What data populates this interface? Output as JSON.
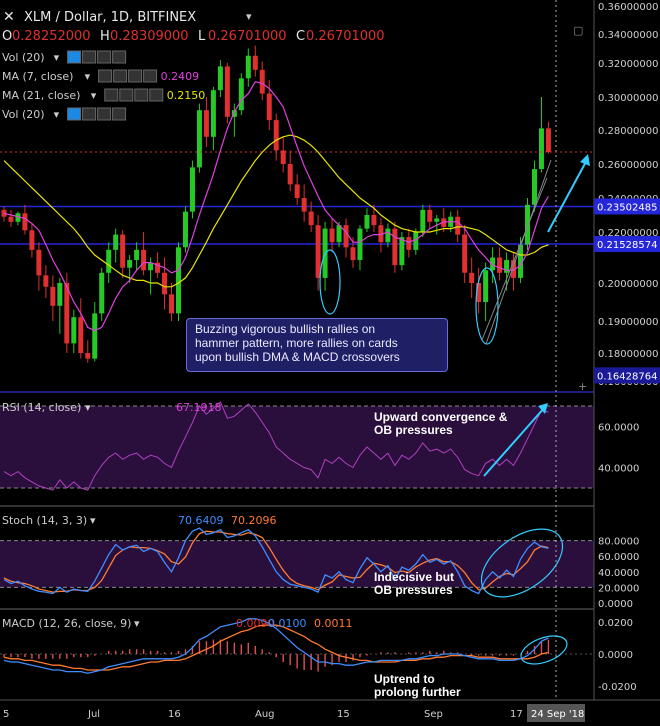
{
  "header": {
    "symbol": "XLM / Dollar, 1D, BITFINEX",
    "ohlc": [
      {
        "k": "O",
        "v": "0.28252000"
      },
      {
        "k": "H",
        "v": "0.28309000"
      },
      {
        "k": "L",
        "v": "0.26701000"
      },
      {
        "k": "C",
        "v": "0.26701000"
      }
    ]
  },
  "legend_rows": [
    {
      "label": "Vol (20)",
      "value": "",
      "value_color": "#ffffff"
    },
    {
      "label": "MA (7, close)",
      "value": "0.2409",
      "value_color": "#e040e0"
    },
    {
      "label": "MA (21, close)",
      "value": "0.2150",
      "value_color": "#e6e600"
    },
    {
      "label": "Vol (20)",
      "value": "",
      "value_color": "#ffffff"
    }
  ],
  "price_axis": {
    "ticks": [
      "0.36000000",
      "0.34000000",
      "0.32000000",
      "0.30000000",
      "0.28000000",
      "0.26000000",
      "0.24000000",
      "0.22000000",
      "0.20000000",
      "0.19000000",
      "0.18000000",
      "0.16000000"
    ],
    "tags": [
      {
        "label": "0.23502485",
        "value": 0.23502485,
        "color": "#2626d9"
      },
      {
        "label": "0.21528574",
        "value": 0.21528574,
        "color": "#2626d9"
      },
      {
        "label": "0.16428764",
        "value": 0.164,
        "color": "#1a1a99"
      }
    ]
  },
  "callout": {
    "lines": [
      "Buzzing vigorous bullish rallies on",
      "hammer pattern, more rallies on cards",
      "upon bullish DMA & MACD crossovers"
    ]
  },
  "rsi_panel": {
    "label": "RSI (14, close)",
    "value": "67.1918",
    "ticks": [
      "60.0000",
      "40.0000"
    ],
    "annotation": [
      "Upward convergence &",
      "OB pressures"
    ]
  },
  "stoch_panel": {
    "label": "Stoch (14, 3, 3)",
    "k": "70.6409",
    "d": "70.2096",
    "ticks": [
      "80.0000",
      "60.0000",
      "40.0000",
      "20.0000",
      "0.0000"
    ],
    "annotation": [
      "Indecisive but",
      "OB pressures"
    ]
  },
  "macd_panel": {
    "label": "MACD (12, 26, close, 9)",
    "hist": "0.0090",
    "macd": "0.0100",
    "signal": "0.0011",
    "ticks": [
      "0.0200",
      "0.0000",
      "-0.0200"
    ],
    "annotation": [
      "Uptrend to",
      "prolong further"
    ]
  },
  "x_axis": {
    "labels": [
      "5",
      "Jul",
      "16",
      "Aug",
      "15",
      "Sep",
      "17"
    ],
    "current": "24 Sep '18"
  },
  "colors": {
    "up": "#26c926",
    "down": "#e03030",
    "ma7": "#e040e0",
    "ma21": "#e6e600",
    "hline": "#2626d9",
    "annotation": "#33ccff"
  },
  "chart_data": {
    "type": "candlestick",
    "title": "XLM / Dollar, 1D, BITFINEX",
    "ylim": [
      0.164,
      0.36
    ],
    "ylabel": "",
    "candles": [
      [
        0.233,
        0.235,
        0.226,
        0.229
      ],
      [
        0.229,
        0.233,
        0.223,
        0.226
      ],
      [
        0.226,
        0.232,
        0.224,
        0.231
      ],
      [
        0.231,
        0.236,
        0.219,
        0.221
      ],
      [
        0.221,
        0.225,
        0.21,
        0.213
      ],
      [
        0.213,
        0.216,
        0.198,
        0.203
      ],
      [
        0.203,
        0.207,
        0.196,
        0.199
      ],
      [
        0.199,
        0.203,
        0.19,
        0.194
      ],
      [
        0.194,
        0.202,
        0.186,
        0.2
      ],
      [
        0.2,
        0.204,
        0.18,
        0.183
      ],
      [
        0.183,
        0.193,
        0.18,
        0.191
      ],
      [
        0.191,
        0.196,
        0.176,
        0.18
      ],
      [
        0.18,
        0.184,
        0.173,
        0.176
      ],
      [
        0.176,
        0.195,
        0.174,
        0.192
      ],
      [
        0.192,
        0.206,
        0.19,
        0.204
      ],
      [
        0.204,
        0.216,
        0.2,
        0.213
      ],
      [
        0.213,
        0.222,
        0.208,
        0.219
      ],
      [
        0.219,
        0.221,
        0.202,
        0.206
      ],
      [
        0.206,
        0.211,
        0.2,
        0.209
      ],
      [
        0.209,
        0.216,
        0.205,
        0.213
      ],
      [
        0.213,
        0.22,
        0.203,
        0.205
      ],
      [
        0.205,
        0.21,
        0.197,
        0.208
      ],
      [
        0.208,
        0.212,
        0.202,
        0.204
      ],
      [
        0.204,
        0.21,
        0.193,
        0.197
      ],
      [
        0.197,
        0.2,
        0.19,
        0.192
      ],
      [
        0.192,
        0.216,
        0.19,
        0.214
      ],
      [
        0.214,
        0.235,
        0.212,
        0.232
      ],
      [
        0.232,
        0.262,
        0.228,
        0.258
      ],
      [
        0.258,
        0.296,
        0.255,
        0.292
      ],
      [
        0.292,
        0.3,
        0.27,
        0.276
      ],
      [
        0.276,
        0.306,
        0.268,
        0.304
      ],
      [
        0.304,
        0.322,
        0.3,
        0.318
      ],
      [
        0.318,
        0.32,
        0.284,
        0.288
      ],
      [
        0.288,
        0.296,
        0.276,
        0.292
      ],
      [
        0.292,
        0.314,
        0.289,
        0.311
      ],
      [
        0.311,
        0.33,
        0.306,
        0.325
      ],
      [
        0.325,
        0.332,
        0.312,
        0.316
      ],
      [
        0.316,
        0.321,
        0.298,
        0.302
      ],
      [
        0.302,
        0.31,
        0.28,
        0.286
      ],
      [
        0.286,
        0.29,
        0.262,
        0.268
      ],
      [
        0.268,
        0.276,
        0.255,
        0.26
      ],
      [
        0.26,
        0.268,
        0.244,
        0.248
      ],
      [
        0.248,
        0.254,
        0.236,
        0.24
      ],
      [
        0.24,
        0.248,
        0.226,
        0.232
      ],
      [
        0.232,
        0.238,
        0.22,
        0.224
      ],
      [
        0.224,
        0.23,
        0.198,
        0.202
      ],
      [
        0.202,
        0.226,
        0.198,
        0.222
      ],
      [
        0.222,
        0.228,
        0.212,
        0.216
      ],
      [
        0.216,
        0.226,
        0.214,
        0.224
      ],
      [
        0.224,
        0.228,
        0.21,
        0.214
      ],
      [
        0.214,
        0.218,
        0.206,
        0.209
      ],
      [
        0.209,
        0.224,
        0.205,
        0.222
      ],
      [
        0.222,
        0.234,
        0.22,
        0.23
      ],
      [
        0.23,
        0.236,
        0.22,
        0.224
      ],
      [
        0.224,
        0.228,
        0.212,
        0.216
      ],
      [
        0.216,
        0.225,
        0.214,
        0.222
      ],
      [
        0.222,
        0.226,
        0.204,
        0.207
      ],
      [
        0.207,
        0.22,
        0.205,
        0.218
      ],
      [
        0.218,
        0.222,
        0.21,
        0.213
      ],
      [
        0.213,
        0.222,
        0.211,
        0.22
      ],
      [
        0.22,
        0.236,
        0.218,
        0.233
      ],
      [
        0.233,
        0.236,
        0.222,
        0.226
      ],
      [
        0.226,
        0.23,
        0.219,
        0.228
      ],
      [
        0.228,
        0.234,
        0.22,
        0.223
      ],
      [
        0.223,
        0.232,
        0.22,
        0.229
      ],
      [
        0.229,
        0.233,
        0.216,
        0.219
      ],
      [
        0.219,
        0.224,
        0.2,
        0.204
      ],
      [
        0.204,
        0.21,
        0.196,
        0.2
      ],
      [
        0.2,
        0.206,
        0.192,
        0.195
      ],
      [
        0.195,
        0.208,
        0.19,
        0.205
      ],
      [
        0.205,
        0.214,
        0.2,
        0.21
      ],
      [
        0.21,
        0.214,
        0.201,
        0.204
      ],
      [
        0.204,
        0.212,
        0.198,
        0.209
      ],
      [
        0.209,
        0.212,
        0.198,
        0.202
      ],
      [
        0.202,
        0.218,
        0.2,
        0.215
      ],
      [
        0.215,
        0.24,
        0.213,
        0.236
      ],
      [
        0.236,
        0.262,
        0.232,
        0.257
      ],
      [
        0.257,
        0.3,
        0.255,
        0.281
      ],
      [
        0.281,
        0.285,
        0.266,
        0.267
      ]
    ],
    "ma7": [
      0.231,
      0.23,
      0.229,
      0.228,
      0.225,
      0.221,
      0.215,
      0.209,
      0.204,
      0.199,
      0.195,
      0.192,
      0.188,
      0.187,
      0.188,
      0.192,
      0.196,
      0.199,
      0.201,
      0.205,
      0.208,
      0.208,
      0.207,
      0.206,
      0.204,
      0.205,
      0.21,
      0.218,
      0.23,
      0.242,
      0.254,
      0.268,
      0.281,
      0.291,
      0.298,
      0.302,
      0.309,
      0.308,
      0.305,
      0.3,
      0.294,
      0.282,
      0.27,
      0.259,
      0.25,
      0.241,
      0.233,
      0.228,
      0.224,
      0.22,
      0.216,
      0.216,
      0.218,
      0.219,
      0.219,
      0.22,
      0.218,
      0.217,
      0.216,
      0.217,
      0.219,
      0.222,
      0.224,
      0.226,
      0.226,
      0.226,
      0.222,
      0.217,
      0.213,
      0.21,
      0.207,
      0.206,
      0.205,
      0.205,
      0.207,
      0.212,
      0.221,
      0.234,
      0.241
    ],
    "ma21": [
      0.262,
      0.258,
      0.254,
      0.25,
      0.246,
      0.242,
      0.238,
      0.234,
      0.23,
      0.226,
      0.222,
      0.218,
      0.214,
      0.211,
      0.209,
      0.207,
      0.205,
      0.203,
      0.202,
      0.201,
      0.201,
      0.2,
      0.2,
      0.199,
      0.199,
      0.2,
      0.202,
      0.206,
      0.211,
      0.216,
      0.222,
      0.229,
      0.236,
      0.243,
      0.25,
      0.256,
      0.262,
      0.267,
      0.271,
      0.274,
      0.276,
      0.277,
      0.276,
      0.274,
      0.271,
      0.267,
      0.262,
      0.257,
      0.252,
      0.248,
      0.244,
      0.24,
      0.237,
      0.234,
      0.23,
      0.227,
      0.224,
      0.222,
      0.221,
      0.22,
      0.22,
      0.22,
      0.221,
      0.222,
      0.222,
      0.223,
      0.223,
      0.222,
      0.221,
      0.219,
      0.217,
      0.215,
      0.213,
      0.212,
      0.211,
      0.211,
      0.212,
      0.214,
      0.215
    ],
    "rsi": [
      38,
      36,
      38,
      35,
      33,
      31,
      30,
      29,
      34,
      30,
      33,
      30,
      29,
      36,
      41,
      45,
      47,
      44,
      46,
      47,
      44,
      46,
      45,
      42,
      40,
      48,
      55,
      62,
      70,
      66,
      69,
      72,
      64,
      65,
      68,
      71,
      67,
      62,
      57,
      50,
      47,
      44,
      42,
      40,
      39,
      35,
      44,
      42,
      45,
      42,
      40,
      46,
      50,
      47,
      44,
      47,
      41,
      46,
      44,
      47,
      52,
      48,
      49,
      47,
      49,
      45,
      39,
      37,
      36,
      42,
      44,
      41,
      44,
      41,
      47,
      54,
      61,
      68,
      67
    ],
    "stoch_k": [
      30,
      25,
      28,
      22,
      18,
      15,
      14,
      12,
      20,
      14,
      18,
      16,
      15,
      28,
      45,
      62,
      75,
      68,
      72,
      74,
      66,
      70,
      66,
      52,
      40,
      58,
      80,
      92,
      96,
      88,
      90,
      94,
      84,
      86,
      90,
      94,
      86,
      72,
      56,
      40,
      30,
      24,
      22,
      20,
      18,
      14,
      36,
      32,
      40,
      30,
      26,
      44,
      58,
      50,
      40,
      48,
      30,
      46,
      42,
      50,
      62,
      52,
      56,
      50,
      54,
      40,
      22,
      16,
      12,
      30,
      40,
      32,
      42,
      34,
      56,
      70,
      78,
      72,
      70
    ],
    "stoch_d": [
      32,
      28,
      26,
      25,
      22,
      18,
      16,
      14,
      15,
      15,
      17,
      16,
      16,
      20,
      29,
      45,
      61,
      68,
      72,
      71,
      71,
      70,
      67,
      63,
      53,
      50,
      59,
      77,
      89,
      92,
      91,
      91,
      89,
      88,
      87,
      90,
      88,
      84,
      71,
      56,
      42,
      31,
      25,
      22,
      20,
      17,
      23,
      27,
      36,
      34,
      32,
      33,
      43,
      51,
      49,
      46,
      39,
      41,
      39,
      46,
      51,
      55,
      57,
      53,
      53,
      48,
      39,
      26,
      17,
      19,
      27,
      34,
      38,
      36,
      44,
      53,
      68,
      73,
      71
    ],
    "macd": [
      -0.004,
      -0.005,
      -0.005,
      -0.006,
      -0.007,
      -0.008,
      -0.009,
      -0.01,
      -0.01,
      -0.011,
      -0.011,
      -0.011,
      -0.012,
      -0.011,
      -0.01,
      -0.008,
      -0.007,
      -0.006,
      -0.005,
      -0.004,
      -0.003,
      -0.003,
      -0.003,
      -0.003,
      -0.003,
      -0.002,
      0.0,
      0.004,
      0.009,
      0.011,
      0.014,
      0.017,
      0.018,
      0.019,
      0.02,
      0.022,
      0.022,
      0.021,
      0.019,
      0.016,
      0.012,
      0.008,
      0.004,
      0.001,
      -0.002,
      -0.005,
      -0.005,
      -0.006,
      -0.006,
      -0.007,
      -0.007,
      -0.006,
      -0.005,
      -0.005,
      -0.004,
      -0.004,
      -0.004,
      -0.004,
      -0.003,
      -0.003,
      -0.002,
      -0.001,
      -0.001,
      0.0,
      0.0,
      0.0,
      -0.001,
      -0.002,
      -0.003,
      -0.003,
      -0.003,
      -0.004,
      -0.004,
      -0.004,
      -0.003,
      -0.001,
      0.003,
      0.008,
      0.01
    ],
    "signal": [
      -0.002,
      -0.003,
      -0.003,
      -0.004,
      -0.004,
      -0.005,
      -0.006,
      -0.007,
      -0.007,
      -0.008,
      -0.009,
      -0.009,
      -0.01,
      -0.01,
      -0.01,
      -0.01,
      -0.009,
      -0.008,
      -0.008,
      -0.007,
      -0.006,
      -0.005,
      -0.005,
      -0.004,
      -0.004,
      -0.004,
      -0.003,
      -0.001,
      0.001,
      0.003,
      0.005,
      0.008,
      0.01,
      0.012,
      0.014,
      0.015,
      0.017,
      0.018,
      0.018,
      0.018,
      0.017,
      0.015,
      0.013,
      0.011,
      0.008,
      0.006,
      0.003,
      0.001,
      -0.001,
      -0.002,
      -0.003,
      -0.004,
      -0.004,
      -0.005,
      -0.005,
      -0.005,
      -0.005,
      -0.004,
      -0.004,
      -0.004,
      -0.003,
      -0.003,
      -0.002,
      -0.002,
      -0.001,
      -0.001,
      -0.001,
      -0.001,
      -0.002,
      -0.002,
      -0.002,
      -0.003,
      -0.003,
      -0.003,
      -0.003,
      -0.003,
      -0.002,
      0.0,
      0.001
    ]
  }
}
